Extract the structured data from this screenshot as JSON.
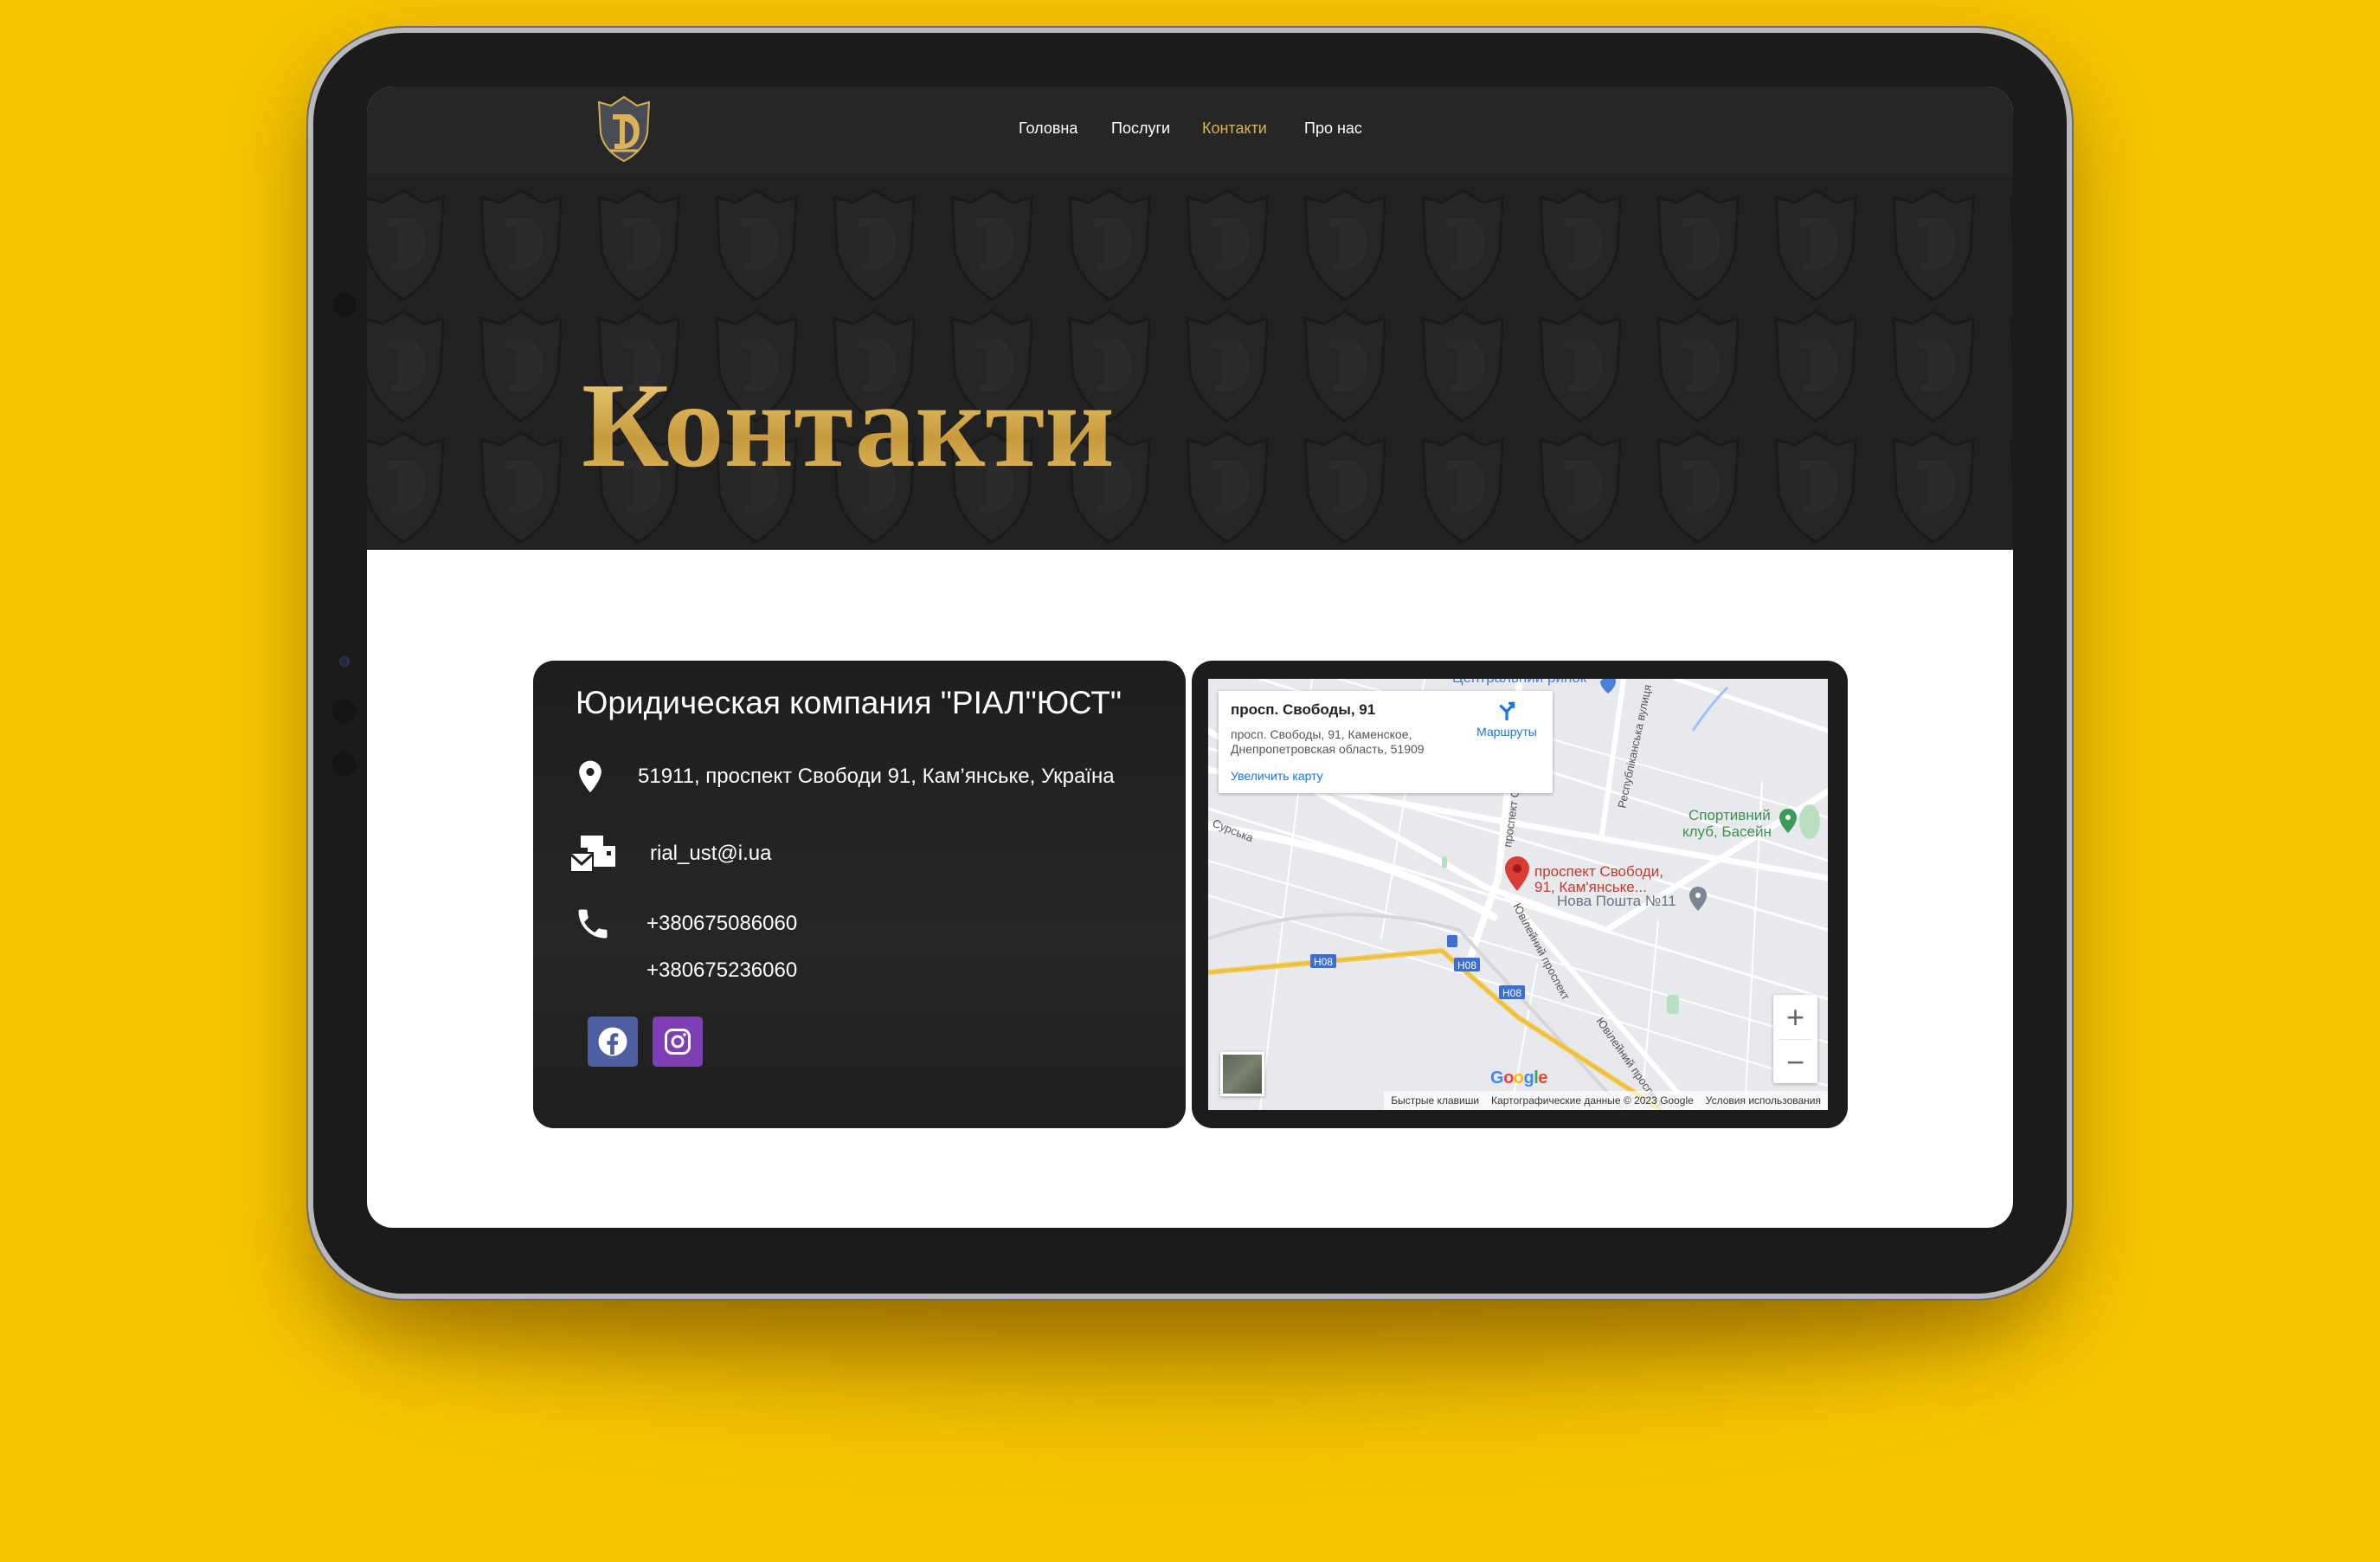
{
  "nav": {
    "items": [
      {
        "label": "Головна",
        "active": false
      },
      {
        "label": "Послуги",
        "active": false
      },
      {
        "label": "Контакти",
        "active": true
      },
      {
        "label": "Про нас",
        "active": false
      }
    ]
  },
  "hero": {
    "title": "Контакти"
  },
  "contact": {
    "company": "Юридическая компания \"РІАЛ\"ЮСТ\"",
    "address": "51911, проспект Свободи 91, Кам’янське,  Україна",
    "email": "rial_ust@i.ua",
    "phones": [
      "+380675086060",
      "+380675236060"
    ],
    "socials": [
      {
        "icon": "facebook-icon",
        "color": "#4d5ea1"
      },
      {
        "icon": "instagram-icon",
        "color": "#7d3fb3"
      }
    ]
  },
  "map": {
    "info_title": "просп. Свободы, 91",
    "info_address": "просп. Свободы, 91, Каменское, Днепропетровская область, 51909",
    "directions_label": "Маршруты",
    "enlarge_label": "Увеличить карту",
    "pin_label_1": "проспект Свободи,",
    "pin_label_2": "91, Кам'янське...",
    "labels": {
      "market": "Центральний ринок",
      "sport_1": "Спортивний",
      "sport_2": "клуб, Басейн",
      "nova_poshta": "Нова Пошта №11",
      "surska": "Сурська",
      "respublikanska": "Республіканська вулиця",
      "prospekt": "проспект С",
      "yuvileinyi": "Ювілейний проспект",
      "road": "Н08"
    },
    "zoom_in": "+",
    "zoom_out": "−",
    "google": "Google",
    "attribution": [
      "Быстрые клавиши",
      "Картографические данные © 2023 Google",
      "Условия использования"
    ]
  },
  "colors": {
    "background": "#f6c500",
    "accent_gold": "#d9b25a",
    "map_link": "#1a73e8",
    "pin": "#d93c36"
  }
}
